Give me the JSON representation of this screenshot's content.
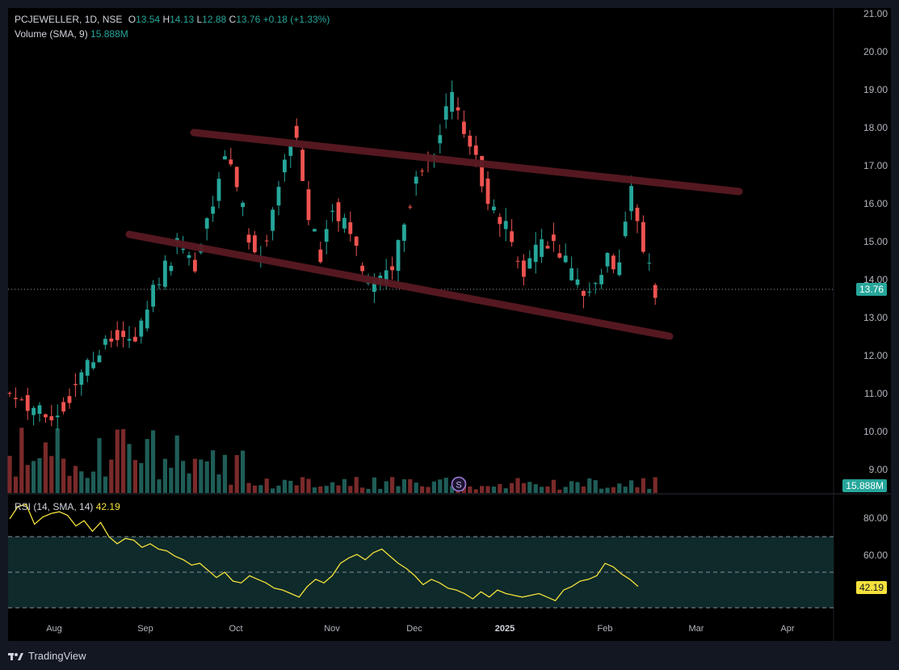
{
  "header": {
    "symbol_line": "PCJEWELLER, 1D, NSE",
    "o_label": "O",
    "o_value": "13.54",
    "h_label": "H",
    "h_value": "14.13",
    "l_label": "L",
    "l_value": "12.88",
    "c_label": "C",
    "c_value": "13.76",
    "change": "+0.18 (+1.33%)",
    "volume_label": "Volume (SMA, 9)",
    "volume_value": "15.888M"
  },
  "rsi": {
    "label": "RSI (14, SMA, 14)",
    "value": "42.19"
  },
  "price_tag": "13.76",
  "volume_tag": "15.888M",
  "rsi_tag": "42.19",
  "footer": {
    "brand": "TradingView"
  },
  "colors": {
    "up": "#26a69a",
    "down": "#ef5350",
    "background": "#000000",
    "rsi_line": "#f5e13c",
    "trendline": "#5a1a22",
    "rsi_band": "#0e2a2a"
  },
  "chart_data": [
    {
      "type": "candlestick",
      "title": "PCJEWELLER, 1D, NSE",
      "y_ticks": [
        "21.00",
        "20.00",
        "19.00",
        "18.00",
        "17.00",
        "16.00",
        "15.00",
        "14.00",
        "13.00",
        "12.00",
        "11.00",
        "10.00",
        "9.00"
      ],
      "x_ticks": [
        "Aug",
        "Sep",
        "Oct",
        "Nov",
        "Dec",
        "2025",
        "Feb",
        "Mar",
        "Apr"
      ],
      "ylim": [
        8.5,
        21.3
      ],
      "last_close": 13.76,
      "ohlc_key_points": [
        {
          "x": "Aug",
          "value": 11.0
        },
        {
          "x": "Sep",
          "value": 11.2
        },
        {
          "x": "Oct",
          "value": 18.7
        },
        {
          "x": "Oct",
          "value": 14.5
        },
        {
          "x": "Oct",
          "value": 18.6
        },
        {
          "x": "Nov",
          "value": 13.7
        },
        {
          "x": "Nov",
          "value": 13.8
        },
        {
          "x": "Dec",
          "value": 16.5
        },
        {
          "x": "Dec",
          "value": 19.3
        },
        {
          "x": "2025",
          "value": 14.0
        },
        {
          "x": "Feb",
          "value": 12.9
        },
        {
          "x": "Feb",
          "value": 16.7
        },
        {
          "x": "Feb",
          "value": 13.76
        }
      ]
    },
    {
      "type": "bar",
      "title": "Volume (SMA, 9)",
      "last_value": "15.888M"
    },
    {
      "type": "line",
      "title": "RSI (14, SMA, 14)",
      "y_ticks": [
        "80.00",
        "60.00"
      ],
      "ylim": [
        10,
        90
      ],
      "bands": [
        70,
        50,
        30
      ],
      "last_value": 42.19,
      "values": [
        80,
        87,
        88,
        77,
        81,
        83,
        84,
        82,
        76,
        79,
        73,
        78,
        70,
        66,
        69,
        68,
        64,
        66,
        63,
        62,
        59,
        57,
        54,
        55,
        51,
        47,
        50,
        45,
        44,
        48,
        46,
        44,
        41,
        40,
        38,
        36,
        42,
        46,
        44,
        48,
        55,
        58,
        60,
        57,
        61,
        63,
        59,
        55,
        52,
        48,
        43,
        46,
        44,
        41,
        40,
        38,
        35,
        39,
        36,
        40,
        38,
        37,
        36,
        37,
        38,
        36,
        34,
        40,
        42,
        45,
        46,
        48,
        55,
        53,
        49,
        46,
        42
      ]
    }
  ]
}
